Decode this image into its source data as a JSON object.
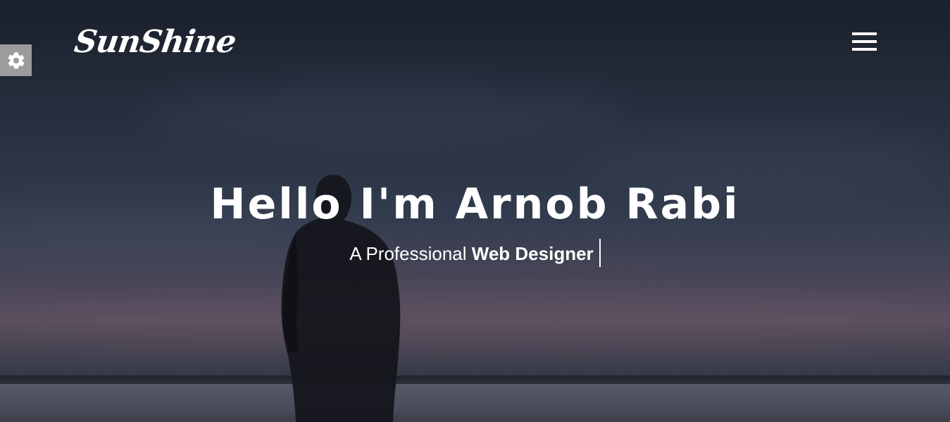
{
  "brand": {
    "logo_text": "SunShine"
  },
  "controls": {
    "settings_icon": "gear-icon",
    "menu_icon": "hamburger-menu-icon"
  },
  "hero": {
    "headline": "Hello I'm Arnob Rabi",
    "subtitle_prefix": "A Professional",
    "subtitle_role": "Web Designer"
  },
  "colors": {
    "text": "#ffffff",
    "settings_tab_bg": "#9c9c9c",
    "background_dark": "#1d2431"
  }
}
